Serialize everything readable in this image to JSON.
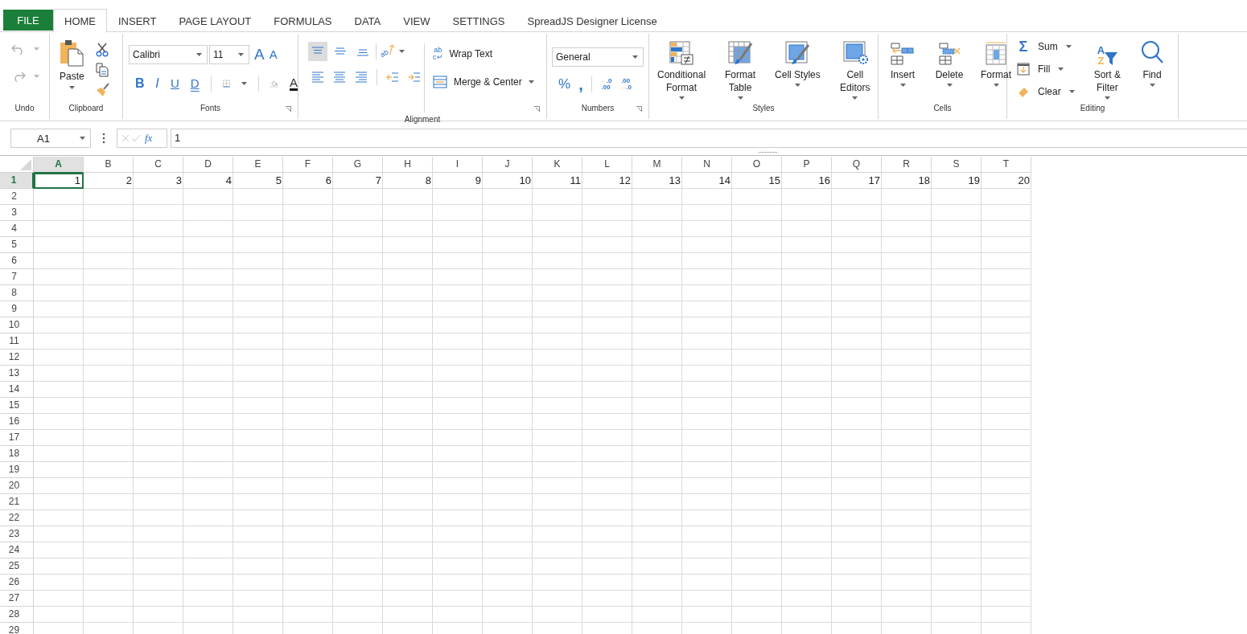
{
  "tabs": [
    {
      "kind": "file",
      "label": "FILE",
      "selected": false
    },
    {
      "kind": "tab",
      "label": "HOME",
      "selected": true
    },
    {
      "kind": "tab",
      "label": "INSERT",
      "selected": false
    },
    {
      "kind": "tab",
      "label": "PAGE LAYOUT",
      "selected": false
    },
    {
      "kind": "tab",
      "label": "FORMULAS",
      "selected": false
    },
    {
      "kind": "tab",
      "label": "DATA",
      "selected": false
    },
    {
      "kind": "tab",
      "label": "VIEW",
      "selected": false
    },
    {
      "kind": "tab",
      "label": "SETTINGS",
      "selected": false
    },
    {
      "kind": "tab",
      "label": "SpreadJS Designer License",
      "selected": false
    }
  ],
  "ribbon": {
    "undo": {
      "label": "Undo",
      "buttons": [
        {
          "kind": "undo",
          "disabled": true
        },
        {
          "kind": "redo",
          "disabled": true
        }
      ]
    },
    "clipboard": {
      "label": "Clipboard",
      "paste": "Paste"
    },
    "fonts": {
      "label": "Fonts",
      "font": "Calibri",
      "size": "11",
      "grow": "A",
      "shrink": "A",
      "styles": [
        {
          "kind": "bold",
          "glyph": "B"
        },
        {
          "kind": "italic",
          "glyph": "I"
        },
        {
          "kind": "underline",
          "glyph": "U"
        },
        {
          "kind": "double-underline",
          "glyph": "D"
        }
      ],
      "font_color": "A"
    },
    "alignment": {
      "label": "Alignment",
      "vertical": [
        {
          "kind": "top",
          "selected": true
        },
        {
          "kind": "middle",
          "selected": false
        },
        {
          "kind": "bottom",
          "selected": false
        }
      ],
      "orientation_glyph": "ab",
      "wrap_glyph": "ab",
      "wrap_glyph_2": "c↵",
      "wrap_text": "Wrap Text",
      "merge": "Merge & Center"
    },
    "numbers": {
      "label": "Numbers",
      "format": "General",
      "percent": "%",
      "comma": ",",
      "decimals": [
        {
          "kind": "increase",
          "arrow": "←",
          "top": ".0",
          "bottom": ".00"
        },
        {
          "kind": "decrease",
          "arrow": "→",
          "top": ".00",
          "bottom": ".0"
        }
      ]
    },
    "styles": {
      "label": "Styles",
      "buttons": [
        {
          "kind": "conditional-format",
          "label": "Conditional\nFormat"
        },
        {
          "kind": "format-table",
          "label": "Format\nTable"
        },
        {
          "kind": "cell-styles",
          "label": "Cell Styles"
        },
        {
          "kind": "cell-editors",
          "label": "Cell\nEditors"
        }
      ]
    },
    "cells": {
      "label": "Cells",
      "buttons": [
        {
          "kind": "insert",
          "label": "Insert"
        },
        {
          "kind": "delete",
          "label": "Delete"
        },
        {
          "kind": "format",
          "label": "Format"
        }
      ]
    },
    "editing": {
      "label": "Editing",
      "items": [
        {
          "kind": "sum",
          "label": "Sum",
          "glyph": "Σ"
        },
        {
          "kind": "fill",
          "label": "Fill"
        },
        {
          "kind": "clear",
          "label": "Clear"
        }
      ],
      "sort_glyphs": [
        "A",
        "Z"
      ],
      "sort": "Sort &\nFilter",
      "find": "Find"
    }
  },
  "formula_bar": {
    "name_box": "A1",
    "fx": "fx",
    "value": "1"
  },
  "sheet": {
    "columns": [
      {
        "label": "A",
        "selected": true
      },
      {
        "label": "B",
        "selected": false
      },
      {
        "label": "C",
        "selected": false
      },
      {
        "label": "D",
        "selected": false
      },
      {
        "label": "E",
        "selected": false
      },
      {
        "label": "F",
        "selected": false
      },
      {
        "label": "G",
        "selected": false
      },
      {
        "label": "H",
        "selected": false
      },
      {
        "label": "I",
        "selected": false
      },
      {
        "label": "J",
        "selected": false
      },
      {
        "label": "K",
        "selected": false
      },
      {
        "label": "L",
        "selected": false
      },
      {
        "label": "M",
        "selected": false
      },
      {
        "label": "N",
        "selected": false
      },
      {
        "label": "O",
        "selected": false
      },
      {
        "label": "P",
        "selected": false
      },
      {
        "label": "Q",
        "selected": false
      },
      {
        "label": "R",
        "selected": false
      },
      {
        "label": "S",
        "selected": false
      },
      {
        "label": "T",
        "selected": false
      }
    ],
    "rows": [
      {
        "label": "1",
        "selected": true,
        "cells": [
          "1",
          "2",
          "3",
          "4",
          "5",
          "6",
          "7",
          "8",
          "9",
          "10",
          "11",
          "12",
          "13",
          "14",
          "15",
          "16",
          "17",
          "18",
          "19",
          "20"
        ]
      },
      {
        "label": "2",
        "selected": false
      },
      {
        "label": "3",
        "selected": false
      },
      {
        "label": "4",
        "selected": false
      },
      {
        "label": "5",
        "selected": false
      },
      {
        "label": "6",
        "selected": false
      },
      {
        "label": "7",
        "selected": false
      },
      {
        "label": "8",
        "selected": false
      },
      {
        "label": "9",
        "selected": false
      },
      {
        "label": "10",
        "selected": false
      },
      {
        "label": "11",
        "selected": false
      },
      {
        "label": "12",
        "selected": false
      },
      {
        "label": "13",
        "selected": false
      },
      {
        "label": "14",
        "selected": false
      },
      {
        "label": "15",
        "selected": false
      },
      {
        "label": "16",
        "selected": false
      },
      {
        "label": "17",
        "selected": false
      },
      {
        "label": "18",
        "selected": false
      },
      {
        "label": "19",
        "selected": false
      },
      {
        "label": "20",
        "selected": false
      },
      {
        "label": "21",
        "selected": false
      },
      {
        "label": "22",
        "selected": false
      },
      {
        "label": "23",
        "selected": false
      },
      {
        "label": "24",
        "selected": false
      },
      {
        "label": "25",
        "selected": false
      },
      {
        "label": "26",
        "selected": false
      },
      {
        "label": "27",
        "selected": false
      },
      {
        "label": "28",
        "selected": false
      },
      {
        "label": "29",
        "selected": false
      }
    ]
  }
}
